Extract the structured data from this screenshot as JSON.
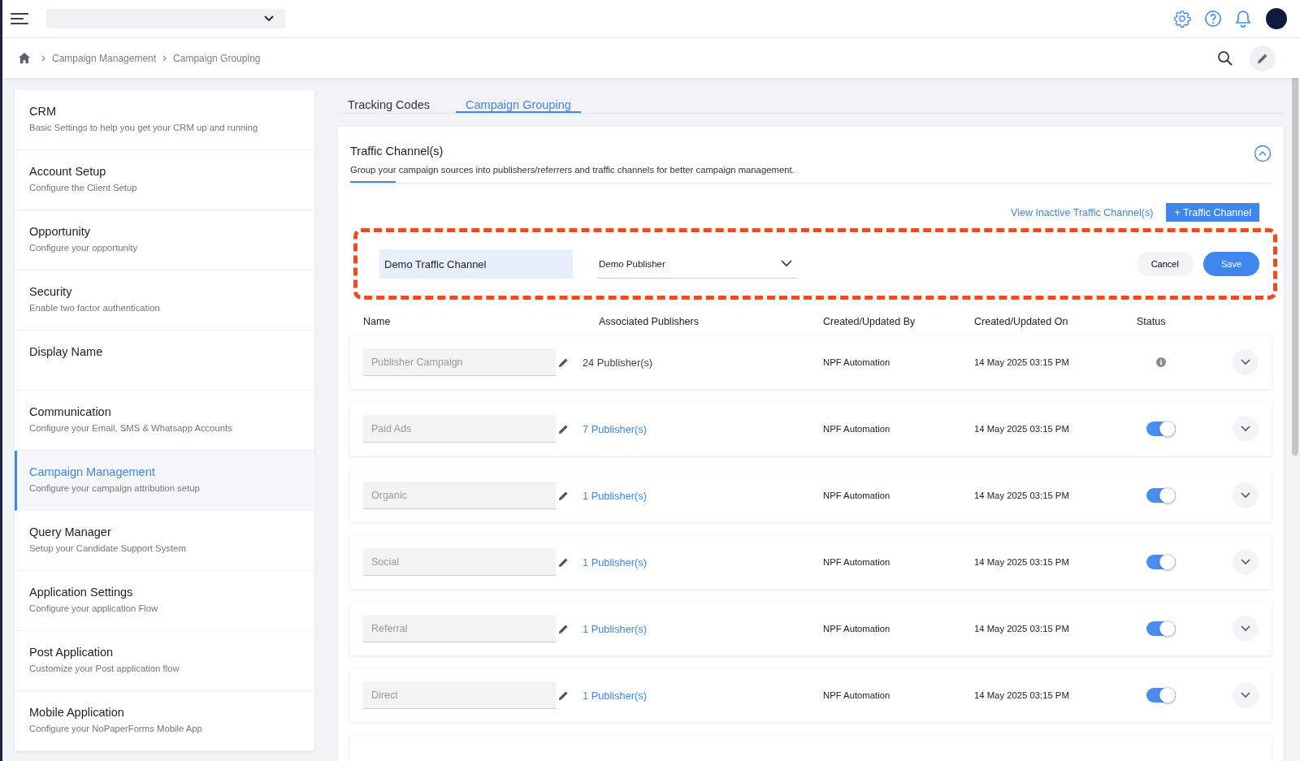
{
  "breadcrumb": [
    "Campaign Management",
    "Campaign Grouping"
  ],
  "sidebar": {
    "items": [
      {
        "title": "CRM",
        "subtitle": "Basic Settings to help you get your CRM up and running",
        "selected": false
      },
      {
        "title": "Account Setup",
        "subtitle": "Configure the Client Setup",
        "selected": false
      },
      {
        "title": "Opportunity",
        "subtitle": "Configure your opportunity",
        "selected": false
      },
      {
        "title": "Security",
        "subtitle": "Enable two factor authentication",
        "selected": false
      },
      {
        "title": "Display Name",
        "selected": false
      },
      {
        "title": "Communication",
        "subtitle": "Configure your Email, SMS & Whatsapp Accounts",
        "selected": false
      },
      {
        "title": "Campaign Management",
        "subtitle": "Configure your campaign attribution setup",
        "selected": true
      },
      {
        "title": "Query Manager",
        "subtitle": "Setup your Candidate Support System",
        "selected": false
      },
      {
        "title": "Application Settings",
        "subtitle": "Configure your application Flow",
        "selected": false
      },
      {
        "title": "Post Application",
        "subtitle": "Customize your Post application flow",
        "selected": false
      },
      {
        "title": "Mobile Application",
        "subtitle": "Configure your NoPaperForms Mobile App",
        "selected": false
      }
    ]
  },
  "tabs": [
    {
      "label": "Tracking Codes",
      "selected": false
    },
    {
      "label": "Campaign Grouping",
      "selected": true
    }
  ],
  "card": {
    "title": "Traffic Channel(s)",
    "description": "Group your campaign sources into publishers/referrers and traffic channels for better campaign management.",
    "inactive_link": "View Inactive Traffic Channel(s)",
    "add_button": "+ Traffic Channel",
    "new_entry": {
      "name": "Demo Traffic Channel",
      "publisher": "Demo Publisher",
      "cancel": "Cancel",
      "save": "Save"
    },
    "columns": [
      "Name",
      "Associated Publishers",
      "Created/Updated By",
      "Created/Updated On",
      "Status"
    ],
    "rows": [
      {
        "name": "Publisher Campaign",
        "publishers": "24 Publisher(s)",
        "linked": false,
        "by": "NPF Automation",
        "on": "14 May 2025 03:15 PM",
        "status": {
          "kind": "info"
        }
      },
      {
        "name": "Paid Ads",
        "publishers": "7 Publisher(s)",
        "linked": true,
        "by": "NPF Automation",
        "on": "14 May 2025 03:15 PM",
        "status": {
          "kind": "toggle",
          "on": true
        }
      },
      {
        "name": "Organic",
        "publishers": "1 Publisher(s)",
        "linked": true,
        "by": "NPF Automation",
        "on": "14 May 2025 03:15 PM",
        "status": {
          "kind": "toggle",
          "on": true
        }
      },
      {
        "name": "Social",
        "publishers": "1 Publisher(s)",
        "linked": true,
        "by": "NPF Automation",
        "on": "14 May 2025 03:15 PM",
        "status": {
          "kind": "toggle",
          "on": true
        }
      },
      {
        "name": "Referral",
        "publishers": "1 Publisher(s)",
        "linked": true,
        "by": "NPF Automation",
        "on": "14 May 2025 03:15 PM",
        "status": {
          "kind": "toggle",
          "on": true
        }
      },
      {
        "name": "Direct",
        "publishers": "1 Publisher(s)",
        "linked": true,
        "by": "NPF Automation",
        "on": "14 May 2025 03:15 PM",
        "status": {
          "kind": "toggle",
          "on": true
        }
      }
    ]
  }
}
